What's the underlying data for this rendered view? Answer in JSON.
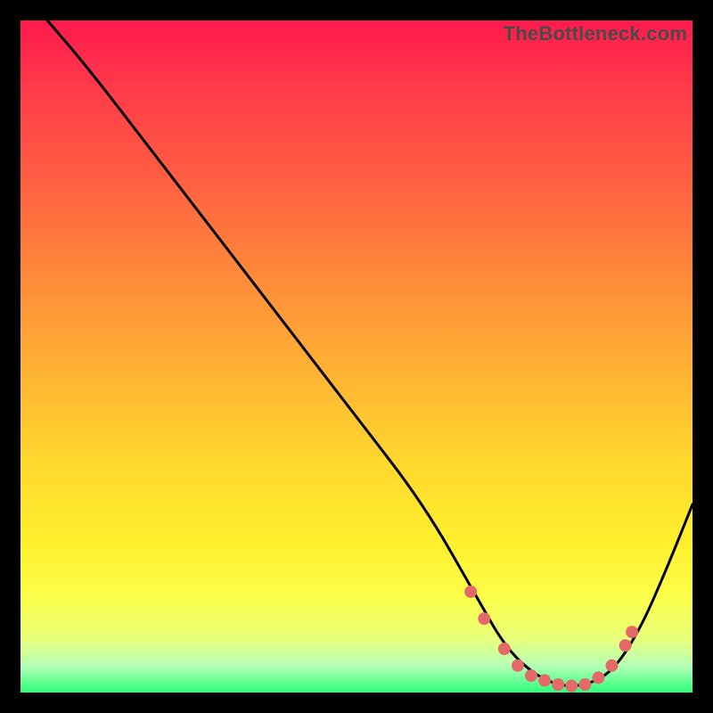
{
  "watermark": "TheBottleneck.com",
  "chart_data": {
    "type": "line",
    "title": "",
    "xlabel": "",
    "ylabel": "",
    "xlim": [
      0,
      100
    ],
    "ylim": [
      0,
      100
    ],
    "grid": false,
    "legend": false,
    "background_gradient": {
      "top": "#ff1a4d",
      "mid": "#ffd82e",
      "bottom": "#2eff7a"
    },
    "series": [
      {
        "name": "bottleneck-curve",
        "color": "#000000",
        "x": [
          4,
          10,
          20,
          30,
          40,
          50,
          60,
          68,
          72,
          76,
          80,
          84,
          88,
          92,
          96,
          100
        ],
        "y": [
          100,
          93,
          80,
          67,
          54,
          41,
          28,
          14,
          7,
          3,
          1,
          1,
          3,
          9,
          18,
          28
        ]
      }
    ],
    "markers": {
      "name": "highlight-dots",
      "color": "#e46a6a",
      "radius": 7,
      "x": [
        67,
        69,
        72,
        74,
        76,
        78,
        80,
        82,
        84,
        86,
        88,
        90,
        91
      ],
      "y": [
        15,
        11,
        6.5,
        4,
        2.5,
        1.8,
        1.2,
        1.0,
        1.2,
        2.2,
        4,
        7,
        9
      ]
    }
  }
}
